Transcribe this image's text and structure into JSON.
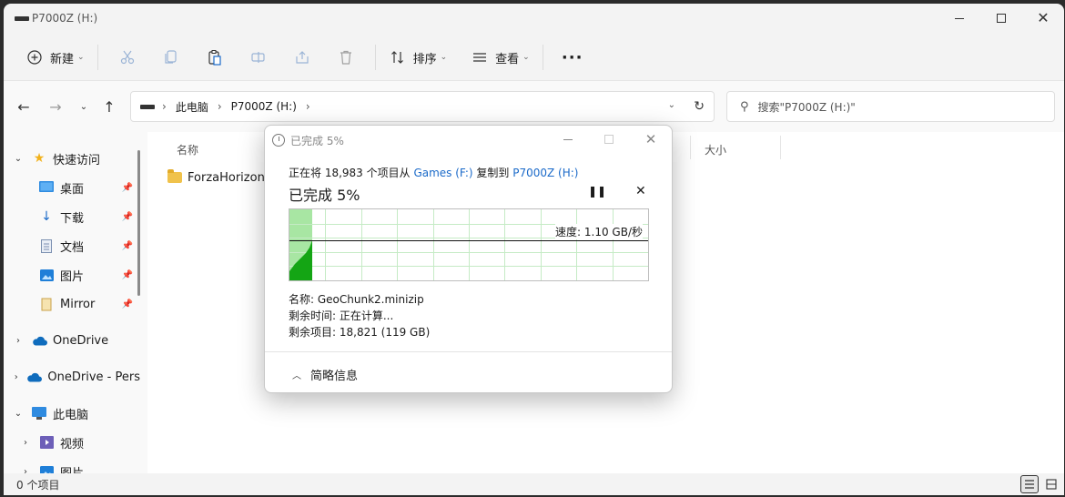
{
  "window": {
    "title": "P7000Z (H:)",
    "controls": {
      "minimize": "minimize-icon",
      "maximize": "maximize-icon",
      "close": "close-icon"
    }
  },
  "toolbar": {
    "new_label": "新建",
    "sort_label": "排序",
    "view_label": "查看",
    "more_label": "···"
  },
  "address": {
    "segments": [
      "此电脑",
      "P7000Z (H:)"
    ],
    "search_placeholder": "搜索\"P7000Z (H:)\""
  },
  "sidebar": {
    "items": [
      {
        "label": "快速访问",
        "icon": "star-icon",
        "expander": "⌄",
        "pinned": false
      },
      {
        "label": "桌面",
        "icon": "desktop-icon",
        "expander": "",
        "pinned": true
      },
      {
        "label": "下载",
        "icon": "download-icon",
        "expander": "",
        "pinned": true
      },
      {
        "label": "文档",
        "icon": "document-icon",
        "expander": "",
        "pinned": true
      },
      {
        "label": "图片",
        "icon": "pictures-icon",
        "expander": "",
        "pinned": true
      },
      {
        "label": "Mirror",
        "icon": "folder-icon",
        "expander": "",
        "pinned": true
      },
      {
        "label": "OneDrive",
        "icon": "cloud-icon",
        "expander": "›",
        "pinned": false
      },
      {
        "label": "OneDrive - Pers",
        "icon": "cloud-icon",
        "expander": "›",
        "pinned": false
      },
      {
        "label": "此电脑",
        "icon": "computer-icon",
        "expander": "⌄",
        "pinned": false
      },
      {
        "label": "视频",
        "icon": "video-icon",
        "expander": "›",
        "pinned": false
      },
      {
        "label": "图片",
        "icon": "pictures-icon",
        "expander": "›",
        "pinned": false
      }
    ]
  },
  "content": {
    "columns": {
      "name": "名称",
      "size": "大小"
    },
    "files": [
      {
        "name": "ForzaHorizon5",
        "type": "folder"
      }
    ]
  },
  "status": {
    "text": "0 个项目"
  },
  "dialog": {
    "title": "已完成 5%",
    "line_prefix": "正在将 18,983 个项目从 ",
    "source": "Games (F:)",
    "line_middle": " 复制到 ",
    "destination": "P7000Z (H:)",
    "headline": "已完成 5%",
    "pause_icon": "pause-icon",
    "stop_icon": "stop-icon",
    "speed_text": "速度: 1.10 GB/秒",
    "progress": 0.05,
    "name_line": "名称: GeoChunk2.minizip",
    "time_line": "剩余时间: 正在计算...",
    "items_line": "剩余项目: 18,821 (119 GB)",
    "footer_label": "简略信息",
    "colors": {
      "fill": "#a8e6a3",
      "graph": "#14a514",
      "grid": "#c5ebc5",
      "link": "#1b6ac9"
    }
  }
}
